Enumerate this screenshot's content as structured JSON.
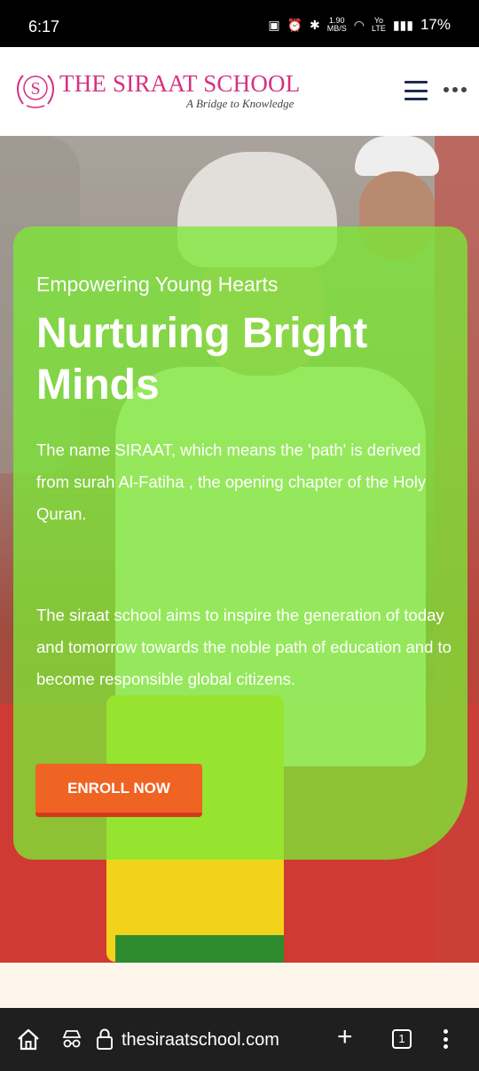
{
  "status_bar": {
    "time": "6:17",
    "network_speed_top": "1.90",
    "network_speed_bottom": "MB/S",
    "lte_top": "Yo",
    "lte_bottom": "LTE",
    "battery": "17%"
  },
  "header": {
    "logo_letter": "S",
    "school_name": "THE SIRAAT SCHOOL",
    "tagline": "A Bridge to Knowledge",
    "brand_color": "#d6317f"
  },
  "hero": {
    "eyebrow": "Empowering Young Hearts",
    "heading": "Nurturing Bright Minds",
    "paragraph_1": "The name SIRAAT, which means the 'path' is derived from surah Al-Fatiha , the opening chapter of the Holy Quran.",
    "paragraph_2": "The siraat school aims to inspire the generation of today and tomorrow towards the noble path of education and to become responsible global citizens.",
    "enroll_label": "ENROLL NOW",
    "card_color": "#7ce836",
    "button_color": "#ef6323"
  },
  "browser": {
    "url": "thesiraatschool.com",
    "tab_count": "1",
    "icons": [
      "home-icon",
      "incognito-icon",
      "lock-icon",
      "plus-icon",
      "tabs-icon",
      "more-vertical-icon"
    ]
  }
}
